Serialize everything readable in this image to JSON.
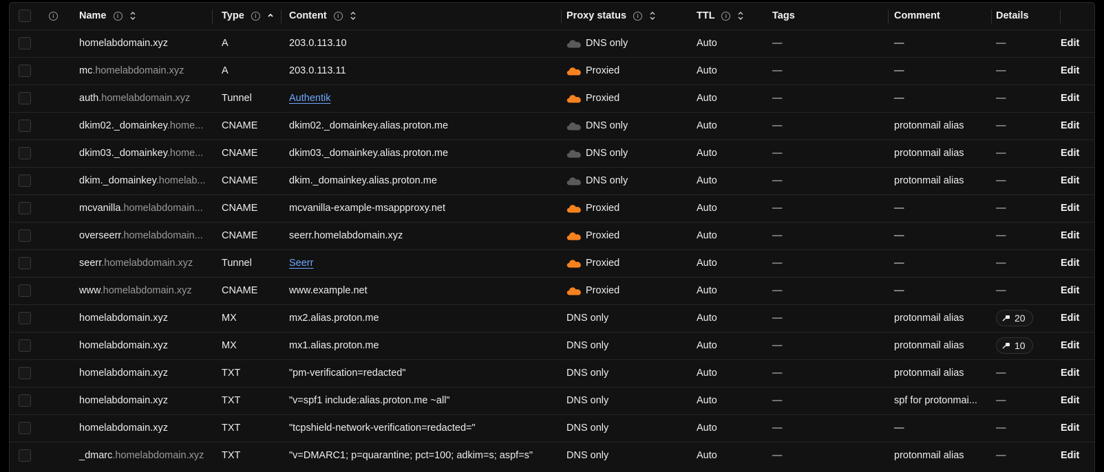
{
  "headers": {
    "name": "Name",
    "type": "Type",
    "content": "Content",
    "proxy_status": "Proxy status",
    "ttl": "TTL",
    "tags": "Tags",
    "comment": "Comment",
    "details": "Details"
  },
  "colors": {
    "proxied_cloud": "#f6821f",
    "dns_only_cloud": "#5a5a5a",
    "link": "#6ea8ff",
    "muted_host": "#9a9a9a"
  },
  "icons": {
    "info": "info-circle-icon",
    "sort": "sort-icon",
    "sort_asc": "sort-ascending-icon",
    "cloud": "cloud-icon",
    "priority": "priority-icon"
  },
  "records": [
    {
      "name_main": "homelabdomain.xyz",
      "name_sub": "",
      "type": "A",
      "content": "203.0.113.10",
      "content_link": false,
      "proxy": "DNS only",
      "cloud": "grey",
      "ttl": "Auto",
      "tags": "—",
      "comment": "—",
      "details": "—",
      "details_badge": false,
      "edit": "Edit"
    },
    {
      "name_main": "mc",
      "name_sub": ".homelabdomain.xyz",
      "type": "A",
      "content": "203.0.113.11",
      "content_link": false,
      "proxy": "Proxied",
      "cloud": "orange",
      "ttl": "Auto",
      "tags": "—",
      "comment": "—",
      "details": "—",
      "details_badge": false,
      "edit": "Edit"
    },
    {
      "name_main": "auth",
      "name_sub": ".homelabdomain.xyz",
      "type": "Tunnel",
      "content": "Authentik",
      "content_link": true,
      "proxy": "Proxied",
      "cloud": "orange",
      "ttl": "Auto",
      "tags": "—",
      "comment": "—",
      "details": "—",
      "details_badge": false,
      "edit": "Edit"
    },
    {
      "name_main": "dkim02._domainkey",
      "name_sub": ".home...",
      "type": "CNAME",
      "content": "dkim02._domainkey.alias.proton.me",
      "content_link": false,
      "proxy": "DNS only",
      "cloud": "grey",
      "ttl": "Auto",
      "tags": "—",
      "comment": "protonmail alias",
      "details": "—",
      "details_badge": false,
      "edit": "Edit"
    },
    {
      "name_main": "dkim03._domainkey",
      "name_sub": ".home...",
      "type": "CNAME",
      "content": "dkim03._domainkey.alias.proton.me",
      "content_link": false,
      "proxy": "DNS only",
      "cloud": "grey",
      "ttl": "Auto",
      "tags": "—",
      "comment": "protonmail alias",
      "details": "—",
      "details_badge": false,
      "edit": "Edit"
    },
    {
      "name_main": "dkim._domainkey",
      "name_sub": ".homelab...",
      "type": "CNAME",
      "content": "dkim._domainkey.alias.proton.me",
      "content_link": false,
      "proxy": "DNS only",
      "cloud": "grey",
      "ttl": "Auto",
      "tags": "—",
      "comment": "protonmail alias",
      "details": "—",
      "details_badge": false,
      "edit": "Edit"
    },
    {
      "name_main": "mcvanilla",
      "name_sub": ".homelabdomain...",
      "type": "CNAME",
      "content": "mcvanilla-example-msappproxy.net",
      "content_link": false,
      "proxy": "Proxied",
      "cloud": "orange",
      "ttl": "Auto",
      "tags": "—",
      "comment": "—",
      "details": "—",
      "details_badge": false,
      "edit": "Edit"
    },
    {
      "name_main": "overseerr",
      "name_sub": ".homelabdomain...",
      "type": "CNAME",
      "content": "seerr.homelabdomain.xyz",
      "content_link": false,
      "proxy": "Proxied",
      "cloud": "orange",
      "ttl": "Auto",
      "tags": "—",
      "comment": "—",
      "details": "—",
      "details_badge": false,
      "edit": "Edit"
    },
    {
      "name_main": "seerr",
      "name_sub": ".homelabdomain.xyz",
      "type": "Tunnel",
      "content": "Seerr",
      "content_link": true,
      "proxy": "Proxied",
      "cloud": "orange",
      "ttl": "Auto",
      "tags": "—",
      "comment": "—",
      "details": "—",
      "details_badge": false,
      "edit": "Edit"
    },
    {
      "name_main": "www",
      "name_sub": ".homelabdomain.xyz",
      "type": "CNAME",
      "content": "www.example.net",
      "content_link": false,
      "proxy": "Proxied",
      "cloud": "orange",
      "ttl": "Auto",
      "tags": "—",
      "comment": "—",
      "details": "—",
      "details_badge": false,
      "edit": "Edit"
    },
    {
      "name_main": "homelabdomain.xyz",
      "name_sub": "",
      "type": "MX",
      "content": "mx2.alias.proton.me",
      "content_link": false,
      "proxy": "DNS only",
      "cloud": "none",
      "ttl": "Auto",
      "tags": "—",
      "comment": "protonmail alias",
      "details": "20",
      "details_badge": true,
      "edit": "Edit"
    },
    {
      "name_main": "homelabdomain.xyz",
      "name_sub": "",
      "type": "MX",
      "content": "mx1.alias.proton.me",
      "content_link": false,
      "proxy": "DNS only",
      "cloud": "none",
      "ttl": "Auto",
      "tags": "—",
      "comment": "protonmail alias",
      "details": "10",
      "details_badge": true,
      "edit": "Edit"
    },
    {
      "name_main": "homelabdomain.xyz",
      "name_sub": "",
      "type": "TXT",
      "content": "\"pm-verification=redacted\"",
      "content_link": false,
      "proxy": "DNS only",
      "cloud": "none",
      "ttl": "Auto",
      "tags": "—",
      "comment": "protonmail alias",
      "details": "—",
      "details_badge": false,
      "edit": "Edit"
    },
    {
      "name_main": "homelabdomain.xyz",
      "name_sub": "",
      "type": "TXT",
      "content": "\"v=spf1 include:alias.proton.me ~all\"",
      "content_link": false,
      "proxy": "DNS only",
      "cloud": "none",
      "ttl": "Auto",
      "tags": "—",
      "comment": "spf for protonmai...",
      "details": "—",
      "details_badge": false,
      "edit": "Edit"
    },
    {
      "name_main": "homelabdomain.xyz",
      "name_sub": "",
      "type": "TXT",
      "content": "\"tcpshield-network-verification=redacted=\"",
      "content_link": false,
      "proxy": "DNS only",
      "cloud": "none",
      "ttl": "Auto",
      "tags": "—",
      "comment": "—",
      "details": "—",
      "details_badge": false,
      "edit": "Edit"
    },
    {
      "name_main": "_dmarc",
      "name_sub": ".homelabdomain.xyz",
      "type": "TXT",
      "content": "\"v=DMARC1; p=quarantine; pct=100; adkim=s; aspf=s\"",
      "content_link": false,
      "proxy": "DNS only",
      "cloud": "none",
      "ttl": "Auto",
      "tags": "—",
      "comment": "protonmail alias",
      "details": "—",
      "details_badge": false,
      "edit": "Edit"
    }
  ]
}
